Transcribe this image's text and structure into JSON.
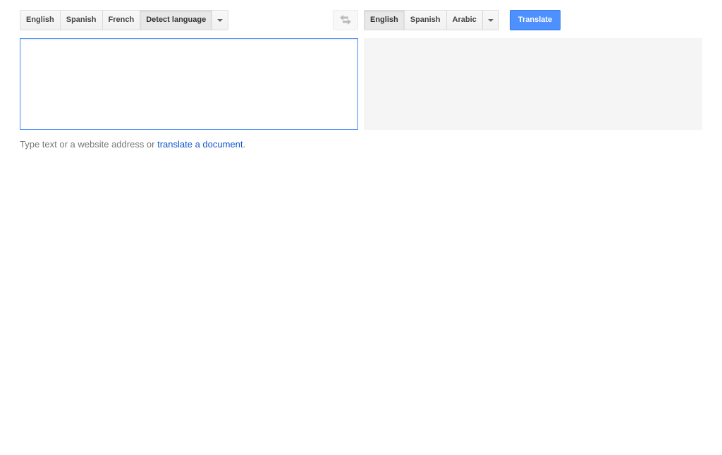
{
  "source_languages": {
    "items": [
      {
        "label": "English"
      },
      {
        "label": "Spanish"
      },
      {
        "label": "French"
      },
      {
        "label": "Detect language",
        "selected": true
      }
    ]
  },
  "target_languages": {
    "items": [
      {
        "label": "English",
        "selected": true
      },
      {
        "label": "Spanish"
      },
      {
        "label": "Arabic"
      }
    ]
  },
  "icons": {
    "source_more": "chevron-down-icon",
    "swap": "swap-languages-icon",
    "target_more": "chevron-down-icon"
  },
  "translate_button": {
    "label": "Translate"
  },
  "source_input": {
    "value": ""
  },
  "hint": {
    "prefix": "Type text or a website address or ",
    "link": "translate a document",
    "suffix": "."
  },
  "colors": {
    "accent": "#4d90fe",
    "link": "#1155cc",
    "result_bg": "#f5f5f5"
  }
}
